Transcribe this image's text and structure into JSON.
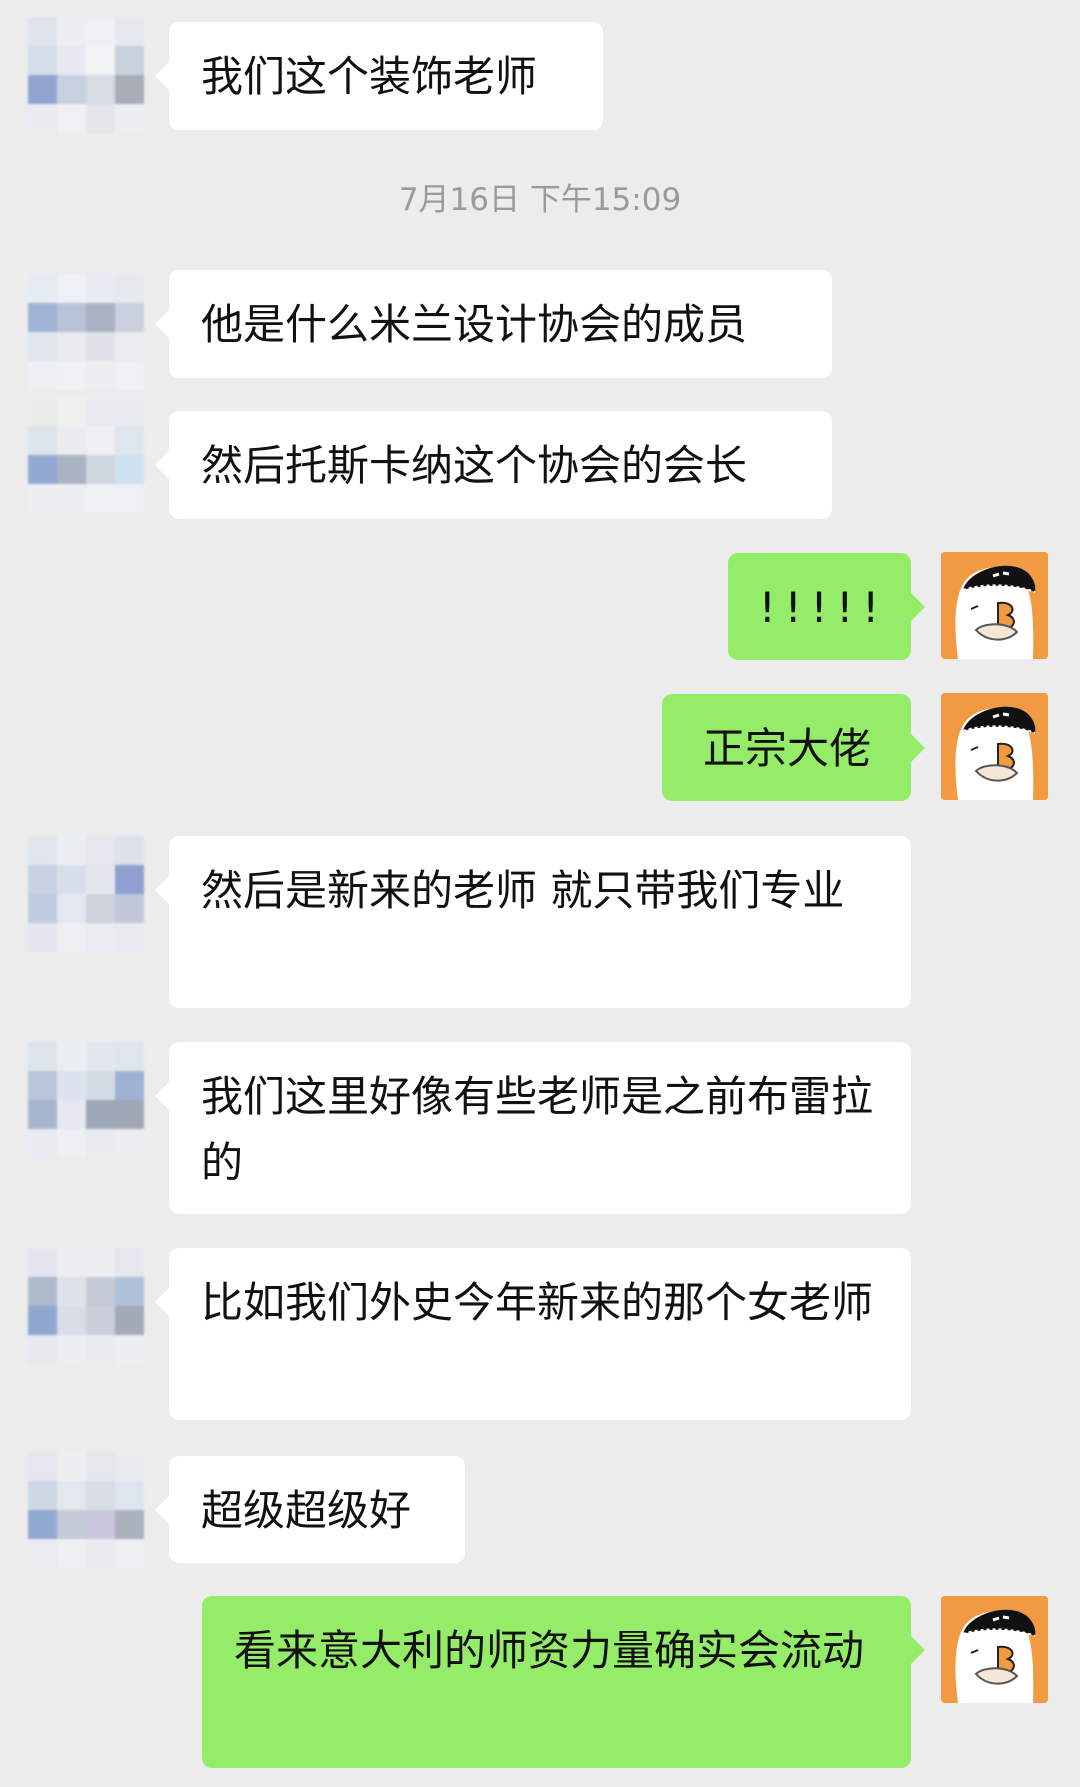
{
  "timestamp": "7月16日 下午15:09",
  "messages": [
    {
      "side": "in",
      "text": "我们这个装饰老师"
    },
    {
      "side": "in",
      "text": "他是什么米兰设计协会的成员"
    },
    {
      "side": "in",
      "text": "然后托斯卡纳这个协会的会长"
    },
    {
      "side": "out",
      "text": "!!!!!"
    },
    {
      "side": "out",
      "text": "正宗大佬"
    },
    {
      "side": "in",
      "text": "然后是新来的老师 就只带我们专业"
    },
    {
      "side": "in",
      "text": "我们这里好像有些老师是之前布雷拉的"
    },
    {
      "side": "in",
      "text": "比如我们外史今年新来的那个女老师"
    },
    {
      "side": "in",
      "text": "超级超级好"
    },
    {
      "side": "out",
      "text": "看来意大利的师资力量确实会流动"
    }
  ],
  "colors": {
    "background": "#ececec",
    "incoming_bubble": "#ffffff",
    "outgoing_bubble": "#95ec69",
    "timestamp_text": "#9a9a9a",
    "self_avatar": "#f29a41"
  }
}
